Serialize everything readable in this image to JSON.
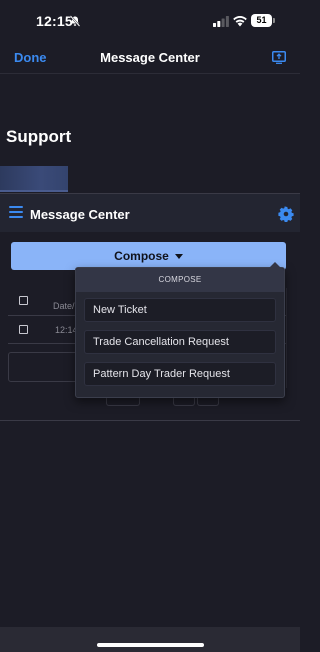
{
  "status_bar": {
    "time": "12:15",
    "battery_level": "51",
    "icons": [
      "bell-off-icon",
      "signal-icon",
      "wifi-icon",
      "battery-icon"
    ]
  },
  "nav": {
    "done_label": "Done",
    "title": "Message Center",
    "share_icon": "share-screen-icon"
  },
  "page": {
    "title": "Support"
  },
  "message_center": {
    "title": "Message Center",
    "menu_icon": "hamburger-menu-icon",
    "settings_icon": "gear-icon"
  },
  "compose": {
    "button_label": "Compose",
    "dropdown_header": "COMPOSE",
    "options": [
      "New Ticket",
      "Trade Cancellation Request",
      "Pattern Day Trader Request"
    ]
  },
  "table": {
    "header_date": "Date/",
    "row_date": "12:14"
  },
  "colors": {
    "background": "#1c1c26",
    "accent": "#3b8af0",
    "compose_button": "#8ab4f8",
    "dropdown_bg": "#262833"
  }
}
